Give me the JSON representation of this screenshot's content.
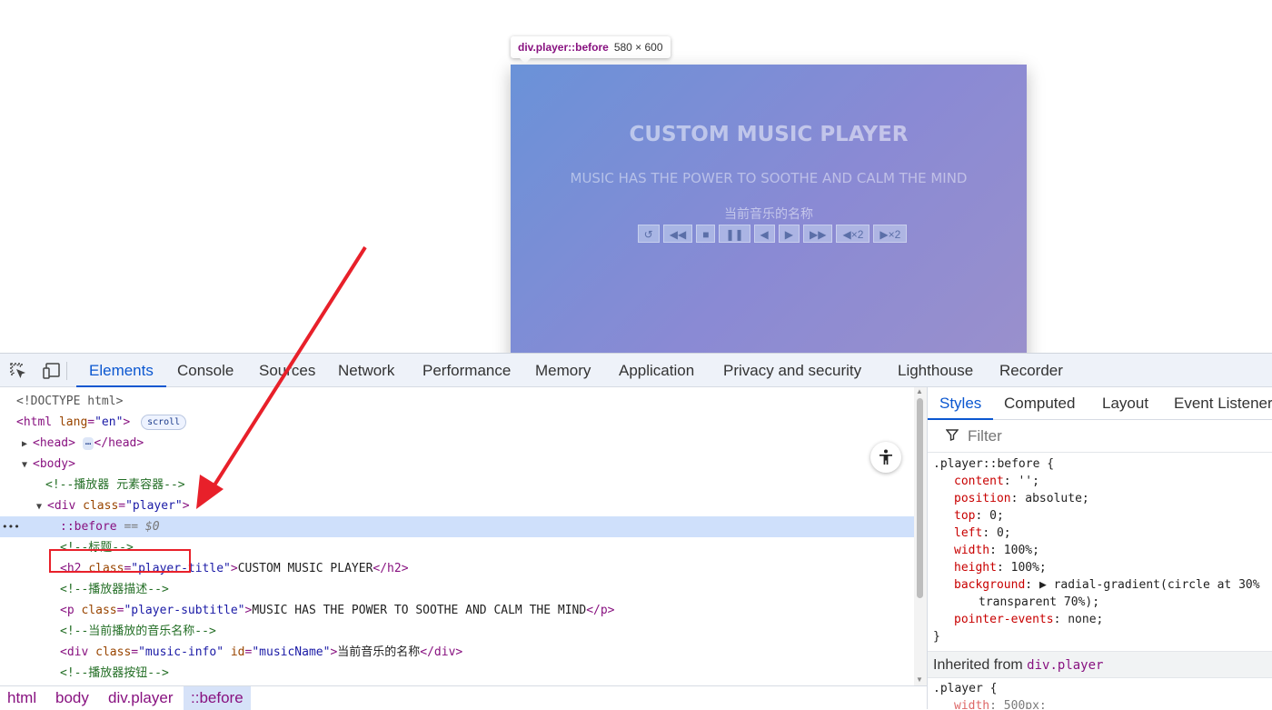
{
  "tooltip": {
    "selector": "div.player::before",
    "dimensions": "580 × 600"
  },
  "player": {
    "title": "CUSTOM MUSIC PLAYER",
    "subtitle": "MUSIC HAS THE POWER TO SOOTHE AND CALM THE MIND",
    "music_name": "当前音乐的名称",
    "controls": [
      "↺",
      "◀◀",
      "■",
      "❚❚",
      "◀",
      "▶",
      "▶▶",
      "◀×2",
      "▶×2"
    ]
  },
  "devtools": {
    "tabs": [
      "Elements",
      "Console",
      "Sources",
      "Network",
      "Performance",
      "Memory",
      "Application",
      "Privacy and security",
      "Lighthouse",
      "Recorder"
    ],
    "icons": {
      "inspect": "inspect-element-icon",
      "device": "device-toolbar-icon"
    },
    "dom": {
      "doctype": "<!DOCTYPE html>",
      "html_open": "<html",
      "html_attr": "lang",
      "html_attr_val": "\"en\"",
      "html_close": ">",
      "scroll_badge": "scroll",
      "head_open": "<head>",
      "head_dots": "…",
      "head_close": "</head>",
      "body_open": "<body>",
      "comment_container": "<!--播放器 元素容器-->",
      "div_open": "<div",
      "div_attr": "class",
      "div_attr_val": "\"player\"",
      "div_close": ">",
      "pseudo": "::before",
      "pseudo_ref": "== $0",
      "comment_title": "<!--标题-->",
      "h2_open": "<h2",
      "h2_attr": "class",
      "h2_attr_val": "\"player-title\"",
      "h2_text": "CUSTOM MUSIC PLAYER",
      "h2_end": "</h2>",
      "comment_desc": "<!--播放器描述-->",
      "p_open": "<p",
      "p_attr": "class",
      "p_attr_val": "\"player-subtitle\"",
      "p_text": "MUSIC HAS THE POWER TO SOOTHE AND CALM THE MIND",
      "p_end": "</p>",
      "comment_music": "<!--当前播放的音乐名称-->",
      "mi_open": "<div",
      "mi_attr1": "class",
      "mi_attr1_val": "\"music-info\"",
      "mi_attr2": "id",
      "mi_attr2_val": "\"musicName\"",
      "mi_text": "当前音乐的名称",
      "mi_end": "</div>",
      "comment_buttons": "<!--播放器按钮-->",
      "gutter_dots": "•••"
    },
    "breadcrumb": [
      "html",
      "body",
      "div.player",
      "::before"
    ],
    "styles": {
      "tabs": [
        "Styles",
        "Computed",
        "Layout",
        "Event Listeners"
      ],
      "filter_placeholder": "Filter",
      "rule_selector": ".player::before {",
      "declarations": [
        {
          "prop": "content",
          "value": "'';"
        },
        {
          "prop": "position",
          "value": "absolute;"
        },
        {
          "prop": "top",
          "value": "0;"
        },
        {
          "prop": "left",
          "value": "0;"
        },
        {
          "prop": "width",
          "value": "100%;"
        },
        {
          "prop": "height",
          "value": "100%;"
        },
        {
          "prop": "background",
          "value": "▶ radial-gradient(circle at 30%"
        },
        {
          "prop": "",
          "value": "transparent 70%);"
        },
        {
          "prop": "pointer-events",
          "value": "none;"
        }
      ],
      "rule_close": "}",
      "inherited_label": "Inherited from",
      "inherited_from": "div.player",
      "next_selector": ".player {",
      "next_prop": "width",
      "next_value": "500px;"
    }
  }
}
